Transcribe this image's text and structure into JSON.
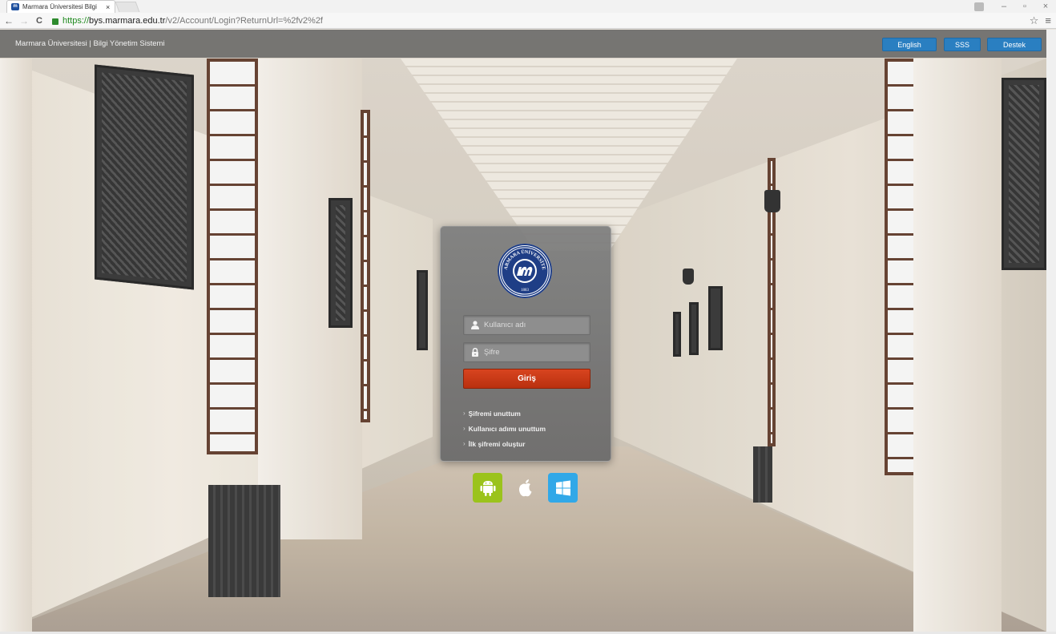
{
  "browser": {
    "tab_title": "Marmara Üniversitesi Bilgi",
    "tab_close": "×",
    "url_secure": "https://",
    "url_host": "bys.marmara.edu.tr",
    "url_path": "/v2/Account/Login?ReturnUrl=%2fv2%2f",
    "back": "←",
    "forward": "→",
    "reload": "C",
    "star": "☆",
    "menu": "≡",
    "minimize": "–",
    "restore": "▫",
    "close": "×",
    "favicon_text": "m"
  },
  "header": {
    "title": "Marmara Üniversitesi | Bilgi Yönetim Sistemi",
    "buttons": {
      "english": "English",
      "sss": "SSS",
      "destek": "Destek"
    }
  },
  "login": {
    "logo_text": "MARMARA ÜNİVERSİTESİ",
    "logo_year": "1883",
    "username_placeholder": "Kullanıcı adı",
    "password_placeholder": "Şifre",
    "submit_label": "Giriş",
    "links": {
      "forgot_password": "Şifremi unuttum",
      "forgot_username": "Kullanıcı adımı unuttum",
      "create_first_password": "İlk şifremi oluştur"
    },
    "link_chevron": "›"
  },
  "apps": {
    "android": "android-icon",
    "apple": "apple-icon",
    "windows": "windows-icon"
  },
  "colors": {
    "header_button": "#2a7fc1",
    "login_button": "#c9391a",
    "android": "#9bc31c",
    "windows": "#31a8e8",
    "seal_blue": "#1f3e86"
  }
}
